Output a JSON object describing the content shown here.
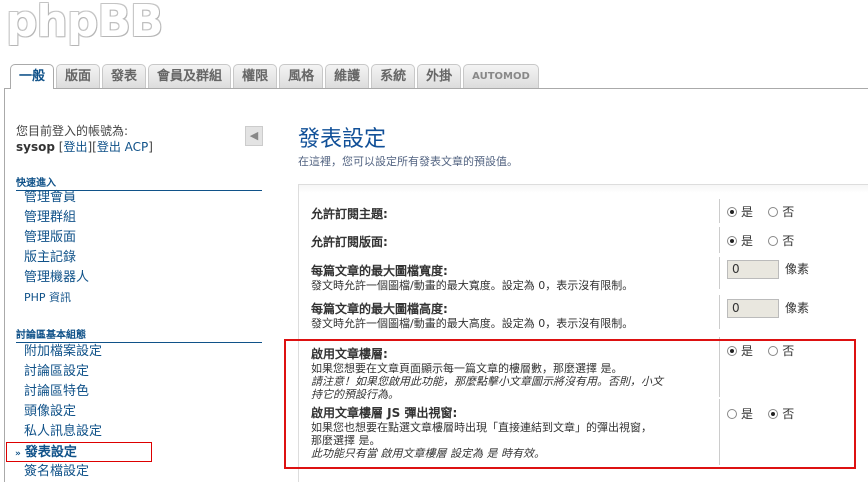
{
  "app": {
    "logo": "phpBB"
  },
  "tabs": [
    {
      "label": "一般",
      "active": true
    },
    {
      "label": "版面"
    },
    {
      "label": "發表"
    },
    {
      "label": "會員及群組"
    },
    {
      "label": "權限"
    },
    {
      "label": "風格"
    },
    {
      "label": "維護"
    },
    {
      "label": "系統"
    },
    {
      "label": "外掛"
    },
    {
      "label": "AUTOMOD"
    }
  ],
  "user": {
    "logged_in_as": "您目前登入的帳號為:",
    "username": "sysop",
    "bracket_open": "[",
    "logout_label": "登出",
    "separator": "][",
    "logout_acp_label": "登出 ACP",
    "bracket_close": "]",
    "collapse_icon": "◀"
  },
  "sidebar": {
    "quick_access": {
      "title": "快速進入",
      "items": [
        "管理會員",
        "管理群組",
        "管理版面",
        "版主記錄",
        "管理機器人",
        "PHP 資訊"
      ]
    },
    "board_config": {
      "title": "討論區基本組態",
      "items": [
        "附加檔案設定",
        "討論區設定",
        "討論區特色",
        "頭像設定",
        "私人訊息設定",
        "發表設定",
        "簽名檔設定"
      ],
      "current": "發表設定",
      "current_marker": "»"
    }
  },
  "main": {
    "title": "發表設定",
    "description": "在這裡，您可以設定所有發表文章的預設值。",
    "settings": [
      {
        "label": "允許訂閱主題:",
        "type": "radio",
        "yes": "是",
        "no": "否",
        "value": "yes"
      },
      {
        "label": "允許訂閱版面:",
        "type": "radio",
        "yes": "是",
        "no": "否",
        "value": "yes"
      },
      {
        "label": "每篇文章的最大圖檔寬度:",
        "sub": "發文時允許一個圖檔/動畫的最大寬度。設定為 0，表示沒有限制。",
        "type": "number",
        "value": "0",
        "unit": "像素"
      },
      {
        "label": "每篇文章的最大圖檔高度:",
        "sub": "發文時允許一個圖檔/動畫的最大高度。設定為 0，表示沒有限制。",
        "type": "number",
        "value": "0",
        "unit": "像素"
      },
      {
        "label": "啟用文章樓層:",
        "sub": "如果您想要在文章頁面顯示每一篇文章的樓層數，那麼選擇 是。",
        "note1": "請注意！如果您啟用此功能，那麼點擊小文章圖示將沒有用。否則，小文",
        "note2": "持它的預設行為。",
        "type": "radio",
        "yes": "是",
        "no": "否",
        "value": "yes"
      },
      {
        "label": "啟用文章樓層 JS 彈出視窗:",
        "sub": "如果您也想要在點選文章樓層時出現「直接連結到文章」的彈出視窗，",
        "sub2": "那麼選擇 是。",
        "note1": "此功能只有當 啟用文章樓層 設定為 是 時有效。",
        "type": "radio",
        "yes": "是",
        "no": "否",
        "value": "no"
      }
    ]
  }
}
